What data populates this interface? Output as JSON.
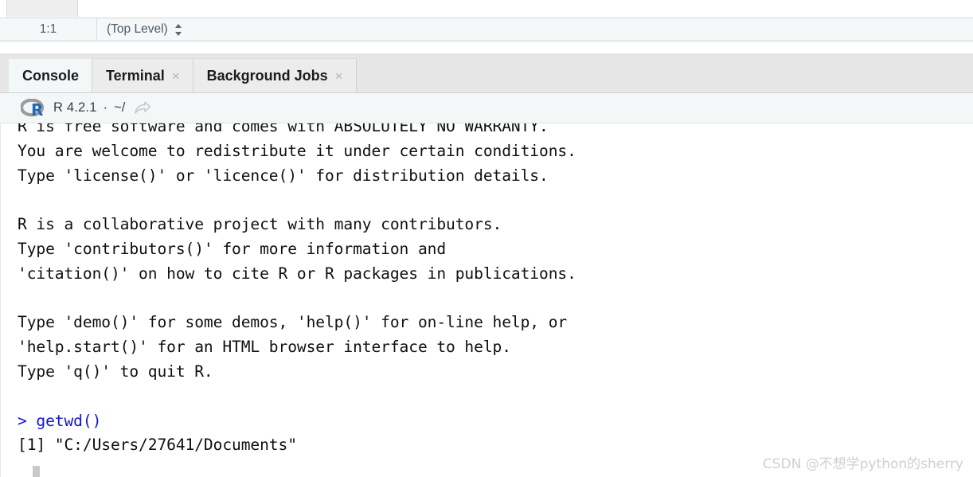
{
  "editor_status": {
    "cursor_position": "1:1",
    "scope": "(Top Level)",
    "scope_icon": "up-down-triangles-icon"
  },
  "pane_tabs": [
    {
      "label": "Console",
      "active": true,
      "closable": false
    },
    {
      "label": "Terminal",
      "active": false,
      "closable": true,
      "close_glyph": "×"
    },
    {
      "label": "Background Jobs",
      "active": false,
      "closable": true,
      "close_glyph": "×"
    }
  ],
  "console_toolbar": {
    "logo_icon": "r-logo-icon",
    "version": "R 4.2.1",
    "separator": "·",
    "working_directory": "~/",
    "share_icon": "open-in-new-window-icon"
  },
  "console_output": [
    {
      "text": "R is free software and comes with ABSOLUTELY NO WARRANTY.",
      "kind": "output"
    },
    {
      "text": "You are welcome to redistribute it under certain conditions.",
      "kind": "output"
    },
    {
      "text": "Type 'license()' or 'licence()' for distribution details.",
      "kind": "output"
    },
    {
      "text": "",
      "kind": "blank"
    },
    {
      "text": "R is a collaborative project with many contributors.",
      "kind": "output"
    },
    {
      "text": "Type 'contributors()' for more information and",
      "kind": "output"
    },
    {
      "text": "'citation()' on how to cite R or R packages in publications.",
      "kind": "output"
    },
    {
      "text": "",
      "kind": "blank"
    },
    {
      "text": "Type 'demo()' for some demos, 'help()' for on-line help, or",
      "kind": "output"
    },
    {
      "text": "'help.start()' for an HTML browser interface to help.",
      "kind": "output"
    },
    {
      "text": "Type 'q()' to quit R.",
      "kind": "output"
    },
    {
      "text": "",
      "kind": "blank"
    },
    {
      "text": "> getwd()",
      "kind": "prompt"
    },
    {
      "text": "[1] \"C:/Users/27641/Documents\"",
      "kind": "output"
    }
  ],
  "watermark": "CSDN @不想学python的sherry",
  "colors": {
    "prompt_blue": "#1414cf",
    "output_black": "#101010",
    "tabbar_gray": "#e6e6e6",
    "active_tab": "#f4f7f8",
    "toolbar_bg": "#f4f7f8",
    "r_logo_blue": "#2268b9",
    "r_logo_gray": "#9b9b9b",
    "watermark_gray": "#cfcfcf"
  }
}
